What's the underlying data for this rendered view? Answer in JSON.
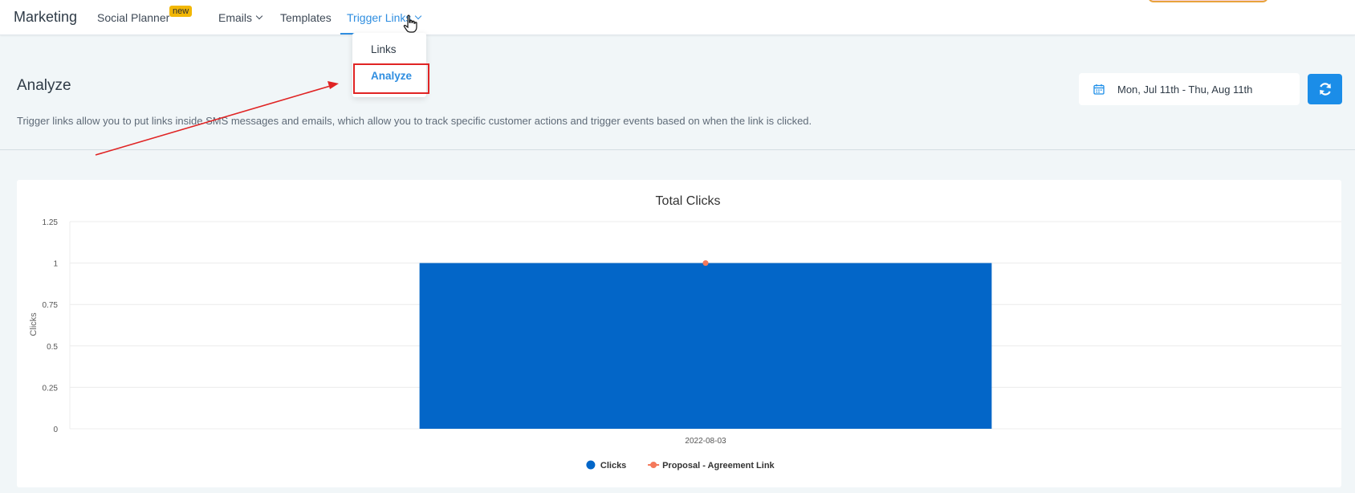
{
  "topbar": {
    "brand": "Marketing",
    "nav": [
      {
        "label": "Social Planner",
        "badge": "new"
      },
      {
        "label": "Emails"
      },
      {
        "label": "Templates"
      },
      {
        "label": "Trigger Links",
        "active": true
      }
    ]
  },
  "dropdown": {
    "items": [
      {
        "label": "Links"
      },
      {
        "label": "Analyze",
        "active": true
      }
    ]
  },
  "page": {
    "title": "Analyze",
    "description": "Trigger links allow you to put links inside SMS messages and emails, which allow you to track specific customer actions and trigger events based on when the link is clicked."
  },
  "date_range": {
    "label": "Mon, Jul 11th - Thu, Aug 11th",
    "icon": "calendar-icon"
  },
  "refresh": {
    "icon": "refresh-icon"
  },
  "colors": {
    "accent": "#1b8de8",
    "bar": "#0366c8",
    "line_point": "#f4795b",
    "highlight": "#e02424"
  },
  "chart_data": {
    "type": "bar",
    "title": "Total Clicks",
    "xlabel": "",
    "ylabel": "Clicks",
    "categories": [
      "2022-08-03"
    ],
    "ylim": [
      0,
      1.25
    ],
    "yticks": [
      "0",
      "0.25",
      "0.5",
      "0.75",
      "1",
      "1.25"
    ],
    "series": [
      {
        "name": "Clicks",
        "type": "bar",
        "values": [
          1
        ],
        "color": "#0366c8"
      },
      {
        "name": "Proposal - Agreement Link",
        "type": "line",
        "values": [
          1
        ],
        "color": "#f4795b"
      }
    ],
    "grid": true,
    "legend": "bottom-center"
  }
}
